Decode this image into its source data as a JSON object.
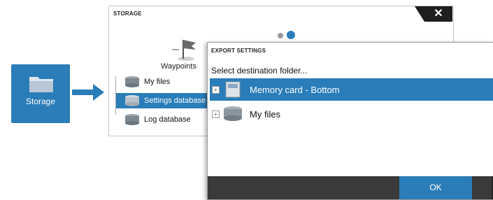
{
  "storage_tile": {
    "label": "Storage",
    "icon": "folder-icon"
  },
  "storage_window": {
    "title": "STORAGE",
    "close_label": "✕",
    "waypoints_label": "Waypoints",
    "sidebar": {
      "items": [
        {
          "label": "My files",
          "icon": "database-icon",
          "selected": false
        },
        {
          "label": "Settings database",
          "icon": "database-icon",
          "selected": true
        },
        {
          "label": "Log database",
          "icon": "database-icon",
          "selected": false
        }
      ]
    }
  },
  "export_dialog": {
    "title": "EXPORT SETTINGS",
    "subtitle": "Select destination folder...",
    "destinations": [
      {
        "label": "Memory card - Bottom",
        "icon": "memory-card-icon",
        "selected": true
      },
      {
        "label": "My files",
        "icon": "database-icon",
        "selected": false
      }
    ],
    "ok_label": "OK"
  },
  "colors": {
    "accent": "#2a7db8",
    "footer": "#3a3a3a",
    "close_bg": "#1e1e1e"
  }
}
